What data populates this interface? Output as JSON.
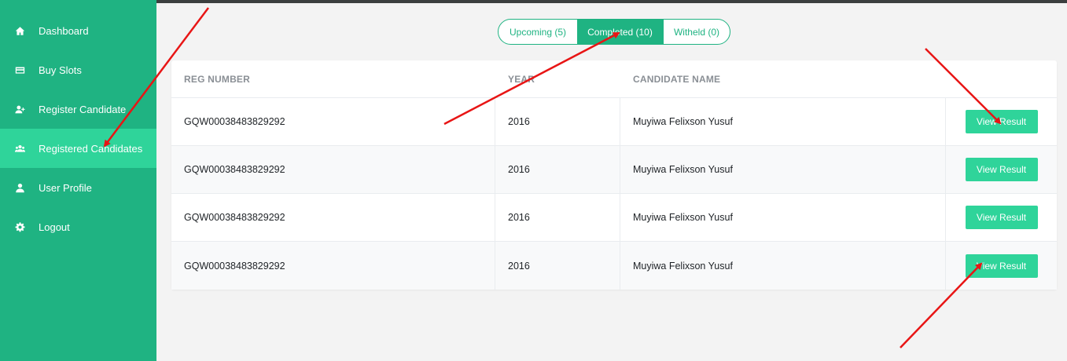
{
  "sidebar": {
    "items": [
      {
        "label": "Dashboard",
        "icon": "home-icon"
      },
      {
        "label": "Buy Slots",
        "icon": "card-icon"
      },
      {
        "label": "Register Candidate",
        "icon": "add-user-icon"
      },
      {
        "label": "Registered Candidates",
        "icon": "users-icon",
        "active": true
      },
      {
        "label": "User Profile",
        "icon": "user-icon"
      },
      {
        "label": "Logout",
        "icon": "gear-icon"
      }
    ]
  },
  "tabs": [
    {
      "label": "Upcoming (5)"
    },
    {
      "label": "Completed (10)",
      "active": true
    },
    {
      "label": "Witheld (0)"
    }
  ],
  "table": {
    "headers": [
      "REG NUMBER",
      "YEAR",
      "CANDIDATE NAME"
    ],
    "rows": [
      {
        "reg": "GQW00038483829292",
        "year": "2016",
        "name": "Muyiwa Felixson Yusuf",
        "action": "View Result"
      },
      {
        "reg": "GQW00038483829292",
        "year": "2016",
        "name": "Muyiwa Felixson Yusuf",
        "action": "View Result"
      },
      {
        "reg": "GQW00038483829292",
        "year": "2016",
        "name": "Muyiwa Felixson Yusuf",
        "action": "View Result"
      },
      {
        "reg": "GQW00038483829292",
        "year": "2016",
        "name": "Muyiwa Felixson Yusuf",
        "action": "View Result"
      }
    ]
  },
  "colors": {
    "sidebar": "#1fb382",
    "accent": "#2fd49a",
    "annotation_arrow": "#e81515"
  }
}
